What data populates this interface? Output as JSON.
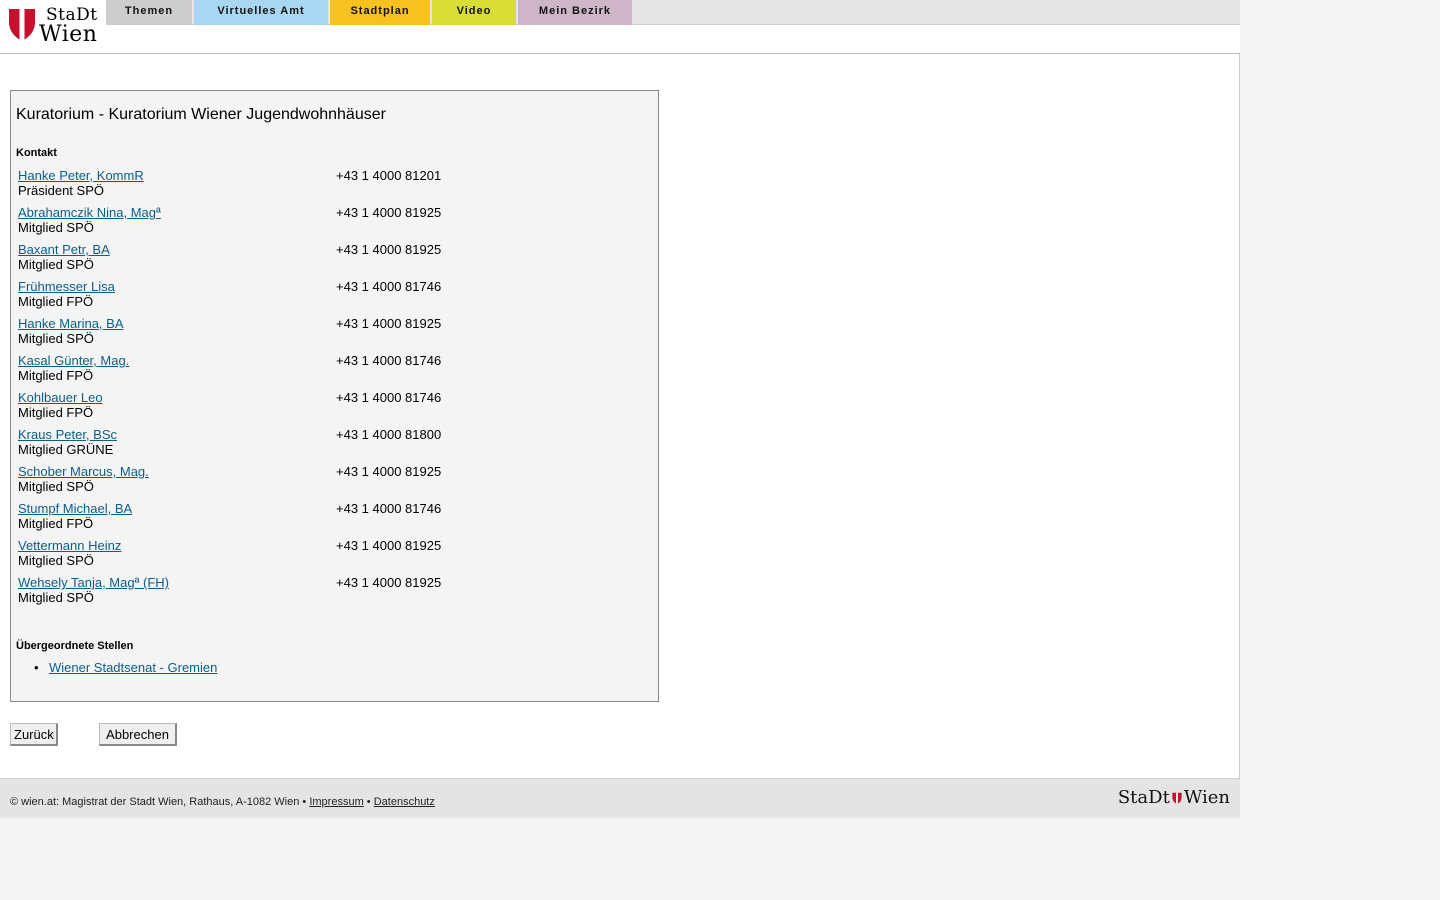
{
  "logo": {
    "line1": "StaDt",
    "line2": "Wien"
  },
  "nav": {
    "tabs": [
      {
        "label": "Themen",
        "color": "#cdcdcd"
      },
      {
        "label": "Virtuelles Amt",
        "color": "#a9d7f1"
      },
      {
        "label": "Stadtplan",
        "color": "#f7c11f"
      },
      {
        "label": "Video",
        "color": "#d8de35"
      },
      {
        "label": "Mein Bezirk",
        "color": "#cfb5c8"
      }
    ]
  },
  "main": {
    "title": "Kuratorium - Kuratorium Wiener Jugendwohnhäuser",
    "contact_heading": "Kontakt",
    "contacts": [
      {
        "name": "Hanke Peter, KommR",
        "role": "Präsident SPÖ",
        "phone": "+43 1 4000 81201"
      },
      {
        "name": "Abrahamczik Nina, Magª",
        "role": "Mitglied SPÖ",
        "phone": "+43 1 4000 81925"
      },
      {
        "name": "Baxant Petr, BA",
        "role": "Mitglied SPÖ",
        "phone": "+43 1 4000 81925"
      },
      {
        "name": "Frühmesser Lisa",
        "role": "Mitglied FPÖ",
        "phone": "+43 1 4000 81746"
      },
      {
        "name": "Hanke Marina, BA",
        "role": "Mitglied SPÖ",
        "phone": "+43 1 4000 81925"
      },
      {
        "name": "Kasal Günter, Mag.",
        "role": "Mitglied FPÖ",
        "phone": "+43 1 4000 81746"
      },
      {
        "name": "Kohlbauer Leo",
        "role": "Mitglied FPÖ",
        "phone": "+43 1 4000 81746"
      },
      {
        "name": "Kraus Peter, BSc",
        "role": "Mitglied GRÜNE",
        "phone": "+43 1 4000 81800"
      },
      {
        "name": "Schober Marcus, Mag.",
        "role": "Mitglied SPÖ",
        "phone": "+43 1 4000 81925"
      },
      {
        "name": "Stumpf Michael, BA",
        "role": "Mitglied FPÖ",
        "phone": "+43 1 4000 81746"
      },
      {
        "name": "Vettermann Heinz",
        "role": "Mitglied SPÖ",
        "phone": "+43 1 4000 81925"
      },
      {
        "name": "Wehsely Tanja, Magª (FH)",
        "role": "Mitglied SPÖ",
        "phone": "+43 1 4000 81925"
      }
    ],
    "parent_heading": "Übergeordnete Stellen",
    "parent_links": [
      "Wiener Stadtsenat - Gremien"
    ]
  },
  "buttons": {
    "back": "Zurück",
    "cancel": "Abbrechen"
  },
  "footer": {
    "copyright": "© wien.at: Magistrat der Stadt Wien, Rathaus, A-1082 Wien •",
    "impressum": "Impressum",
    "separator": "•",
    "datenschutz": "Datenschutz",
    "logo_left": "StaDt",
    "logo_right": "Wien"
  },
  "colors": {
    "link": "#0b5d8c",
    "brand_red": "#c8102e"
  }
}
